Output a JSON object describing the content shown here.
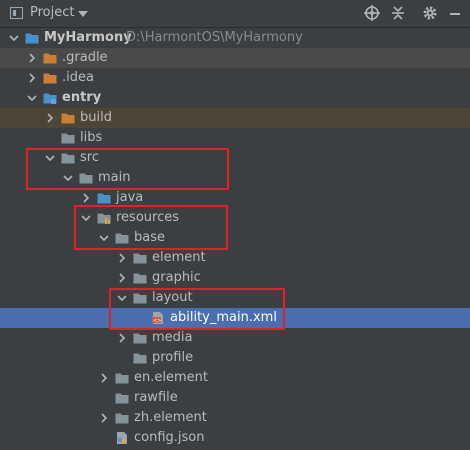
{
  "panel": {
    "title": "Project"
  },
  "tree": [
    {
      "label": "MyHarmony",
      "path": "D:\\HarmontOS\\MyHarmony",
      "bold": true
    },
    {
      "label": ".gradle"
    },
    {
      "label": ".idea"
    },
    {
      "label": "entry",
      "bold": true
    },
    {
      "label": "build"
    },
    {
      "label": "libs"
    },
    {
      "label": "src"
    },
    {
      "label": "main"
    },
    {
      "label": "java"
    },
    {
      "label": "resources"
    },
    {
      "label": "base"
    },
    {
      "label": "element"
    },
    {
      "label": "graphic"
    },
    {
      "label": "layout"
    },
    {
      "label": "ability_main.xml"
    },
    {
      "label": "media"
    },
    {
      "label": "profile"
    },
    {
      "label": "en.element"
    },
    {
      "label": "rawfile"
    },
    {
      "label": "zh.element"
    },
    {
      "label": "config.json"
    }
  ],
  "colors": {
    "background": "#3c3f41",
    "selection": "#4b6eaf",
    "highlight": "#e0202a",
    "folder": "#87939a",
    "folder_orange": "#c87f3a",
    "folder_blue": "#4a8fc7"
  }
}
